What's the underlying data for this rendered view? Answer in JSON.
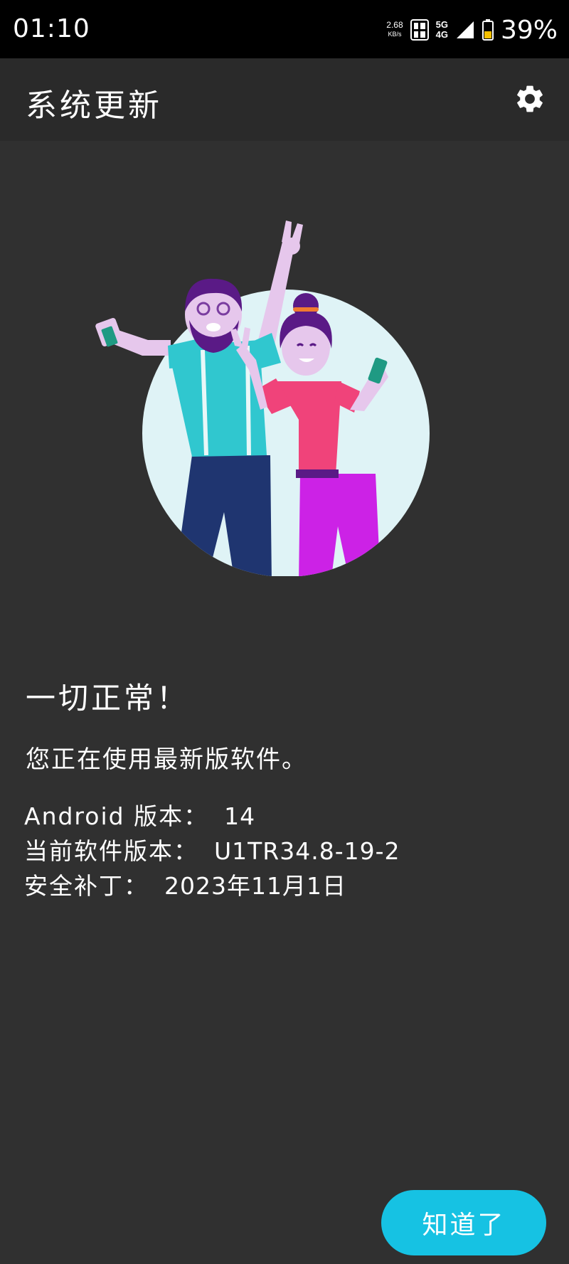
{
  "status_bar": {
    "time": "01:10",
    "net_speed_value": "2.68",
    "net_speed_unit": "KB/s",
    "network_top": "5G",
    "network_bottom": "4G",
    "battery_percent": "39%",
    "icons": [
      "hd-icon",
      "signal-icon",
      "battery-icon"
    ]
  },
  "app_bar": {
    "title": "系统更新",
    "settings_icon": "gear-icon"
  },
  "main": {
    "illustration": "two-people-celebrating-illustration",
    "headline": "一切正常！",
    "subtitle": "您正在使用最新版软件。",
    "info": [
      {
        "label": "Android 版本：",
        "value": "14"
      },
      {
        "label": "当前软件版本：",
        "value": "U1TR34.8-19-2"
      },
      {
        "label": "安全补丁：",
        "value": "2023年11月1日"
      }
    ]
  },
  "footer": {
    "ok_button_label": "知道了"
  },
  "colors": {
    "background": "#303030",
    "app_bar": "#2a2a2a",
    "status_bar": "#000000",
    "accent_button": "#16c2e3"
  }
}
